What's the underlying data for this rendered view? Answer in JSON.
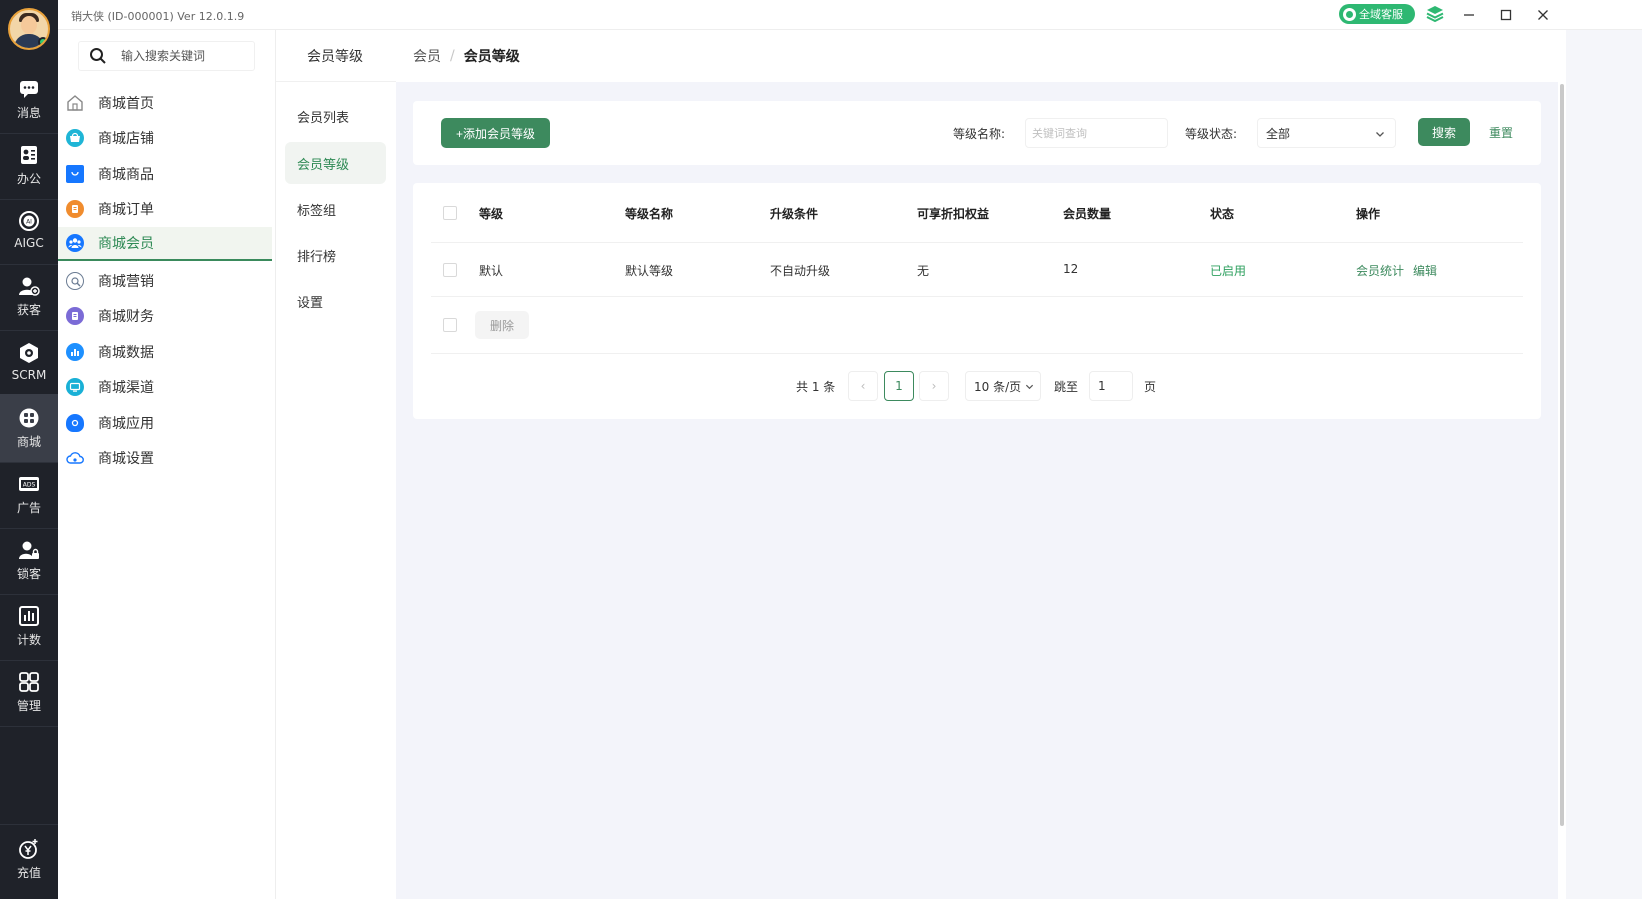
{
  "app": {
    "title": "销大侠  (ID-000001)  Ver 12.0.1.9",
    "service_label": "全域客服"
  },
  "rail": [
    {
      "label": "消息",
      "icon": "message-icon"
    },
    {
      "label": "办公",
      "icon": "office-icon"
    },
    {
      "label": "AIGC",
      "icon": "aigc-icon"
    },
    {
      "label": "获客",
      "icon": "acquire-icon"
    },
    {
      "label": "SCRM",
      "icon": "scrm-icon"
    },
    {
      "label": "商城",
      "icon": "mall-icon"
    },
    {
      "label": "广告",
      "icon": "ads-icon"
    },
    {
      "label": "锁客",
      "icon": "lock-customer-icon"
    },
    {
      "label": "计数",
      "icon": "stats-icon"
    },
    {
      "label": "管理",
      "icon": "grid-icon"
    },
    {
      "label": "充值",
      "icon": "recharge-icon"
    }
  ],
  "search": {
    "placeholder": "输入搜索关键词"
  },
  "sidebar": {
    "items": [
      {
        "label": "商城首页",
        "icon": "home-icon",
        "color": "#888888"
      },
      {
        "label": "商城店铺",
        "icon": "shop-icon",
        "color": "#1fb5d6"
      },
      {
        "label": "商城商品",
        "icon": "bag-icon",
        "color": "#1677ff"
      },
      {
        "label": "商城订单",
        "icon": "order-icon",
        "color": "#f08c2e"
      },
      {
        "label": "商城会员",
        "icon": "members-icon",
        "color": "#1677ff"
      },
      {
        "label": "商城营销",
        "icon": "marketing-icon",
        "color": "#6b7c93"
      },
      {
        "label": "商城财务",
        "icon": "finance-icon",
        "color": "#7b6bd6"
      },
      {
        "label": "商城数据",
        "icon": "data-icon",
        "color": "#1e90ff"
      },
      {
        "label": "商城渠道",
        "icon": "channel-icon",
        "color": "#19b0d6"
      },
      {
        "label": "商城应用",
        "icon": "app-icon",
        "color": "#1677ff"
      },
      {
        "label": "商城设置",
        "icon": "cloud-settings-icon",
        "color": "#1677ff"
      }
    ]
  },
  "subnav": {
    "title": "会员等级",
    "items": [
      {
        "label": "会员列表"
      },
      {
        "label": "会员等级"
      },
      {
        "label": "标签组"
      },
      {
        "label": "排行榜"
      },
      {
        "label": "设置"
      }
    ]
  },
  "breadcrumb": {
    "parent": "会员",
    "sep": "/",
    "current": "会员等级"
  },
  "filter": {
    "add_label": "+添加会员等级",
    "name_label": "等级名称:",
    "name_placeholder": "关键词查询",
    "status_label": "等级状态:",
    "status_value": "全部",
    "search_label": "搜索",
    "reset_label": "重置"
  },
  "table": {
    "headers": [
      "等级",
      "等级名称",
      "升级条件",
      "可享折扣权益",
      "会员数量",
      "状态",
      "操作"
    ],
    "rows": [
      {
        "level": "默认",
        "name": "默认等级",
        "upgrade": "不自动升级",
        "discount": "无",
        "count": "12",
        "status": "已启用",
        "op_stats": "会员统计",
        "op_edit": "编辑"
      }
    ],
    "delete_label": "删除"
  },
  "pager": {
    "total": "共 1 条",
    "prev": "‹",
    "current": "1",
    "next": "›",
    "page_size": "10 条/页",
    "jump_label": "跳至",
    "jump_value": "1",
    "page_suffix": "页"
  },
  "colors": {
    "accent": "#3d8a5e",
    "enabled": "#2ea05f",
    "rail_bg": "#1f2229"
  }
}
